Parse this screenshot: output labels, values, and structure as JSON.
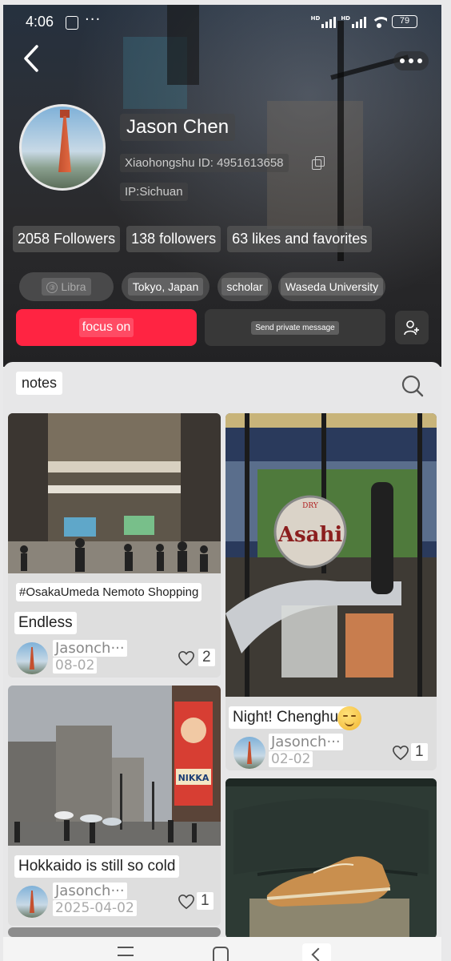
{
  "status_bar": {
    "time": "4:06",
    "dots": "···",
    "network_label": "HD",
    "battery": "79"
  },
  "profile": {
    "name": "Jason Chen",
    "id_text": "Xiaohongshu ID: 4951613658",
    "ip_text": "IP:Sichuan",
    "stats": [
      {
        "label": "2058 Followers"
      },
      {
        "label": "138 followers"
      },
      {
        "label": "63 likes and favorites"
      }
    ],
    "tags": [
      {
        "label": "Libra",
        "icon": "gender-icon",
        "icon_glyph": "③"
      },
      {
        "label": "Tokyo, Japan"
      },
      {
        "label": "scholar"
      },
      {
        "label": "Waseda University"
      }
    ],
    "focus_button": "focus on",
    "message_button": "Send private message"
  },
  "tabs": {
    "notes": "notes"
  },
  "cards": [
    {
      "topic": "#OsakaUmeda Nemoto Shopping",
      "title": "Endless",
      "author": "Jasonch···",
      "date": "08-02",
      "likes": "2"
    },
    {
      "title": "Night! Chenghua",
      "author": "Jasonch···",
      "date": "02-02",
      "likes": "1",
      "image_text": "Asahi",
      "image_subtext": "DRY"
    },
    {
      "title": "Hokkaido is still so cold",
      "author": "Jasonch···",
      "date": "2025-04-02",
      "likes": "1",
      "image_text": "NIKKA"
    },
    {
      "title": ""
    }
  ],
  "colors": {
    "accent": "#ff2442",
    "panel_bg": "#e7e7e8",
    "header_bg": "#2a2a2c"
  },
  "icons": {
    "back": "back-arrow-icon",
    "more": "more-dots-icon",
    "copy": "copy-icon",
    "add_friend": "add-user-icon",
    "search": "search-icon",
    "heart": "heart-icon"
  }
}
